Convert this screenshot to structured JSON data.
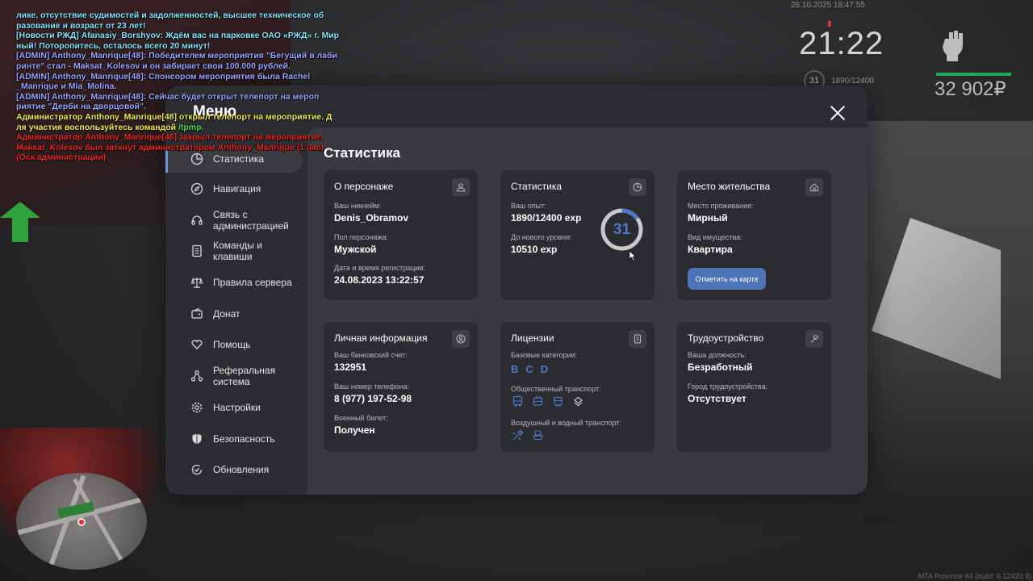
{
  "hud": {
    "datetime": "26.10.2025 18:47:55",
    "time": "21:22",
    "level": "31",
    "exp": "1890/12400",
    "money": "32 902₽",
    "build": "MTA Province #4 (build: 6.12420.9)"
  },
  "chat": [
    {
      "text": "лике, отсутствие судимостей и задолженностей, высшее техническое об",
      "color": "cyan"
    },
    {
      "text": "разование и возраст от 23 лет!",
      "color": "cyan"
    },
    {
      "text": "[Новости РЖД] Afanasiy_Borshyov: Ждём вас на парковке ОАО «РЖД» г. Мир",
      "color": "cyan"
    },
    {
      "text": "ный! Поторопитесь, осталось всего 20 минут!",
      "color": "cyan"
    },
    {
      "text": "[ADMIN] Anthony_Manrique[48]: Победителем мероприятия \"Бегущий в лаби",
      "color": "blue"
    },
    {
      "text": "ринте\" стал - Maksat_Kolesov и он забирает свои 100.000 рублей.",
      "color": "blue"
    },
    {
      "text": "[ADMIN] Anthony_Manrique[48]: Спонсором мероприятия была Rachel",
      "color": "blue"
    },
    {
      "text": "_Manrique и Mia_Molina.",
      "color": "blue"
    },
    {
      "text": "[ADMIN] Anthony_Manrique[48]: Сейчас будет открыт телепорт на мероп",
      "color": "blue"
    },
    {
      "text": "риятие \"Дерби на дворцовой\".",
      "color": "blue"
    },
    {
      "text": "Администратор Anthony_Manrique[48] открыл телепорт на мероприятие. Д",
      "color": "yellow"
    },
    {
      "text": "ля участия воспользуйтесь командой ",
      "color": "yellow",
      "extra": "/tpmp."
    },
    {
      "text": "Администратор Anthony_Manrique[48] закрыл телепорт на мероприятие.",
      "color": "red"
    },
    {
      "text": "Maksat_Kolesov был заткнут администратором Anthony_Manrique (1 час)",
      "color": "red"
    },
    {
      "text": "(Оск.администрации)",
      "color": "red"
    }
  ],
  "menu": {
    "title": "Меню",
    "section_title": "Статистика",
    "sidebar": [
      {
        "label": "Статистика",
        "icon": "pie-chart-icon"
      },
      {
        "label": "Навигация",
        "icon": "compass-icon"
      },
      {
        "label": "Связь с администрацией",
        "icon": "headset-icon"
      },
      {
        "label": "Команды и клавиши",
        "icon": "document-icon"
      },
      {
        "label": "Правила сервера",
        "icon": "scales-icon"
      },
      {
        "label": "Донат",
        "icon": "wallet-icon"
      },
      {
        "label": "Помощь",
        "icon": "heart-hand-icon"
      },
      {
        "label": "Реферальная система",
        "icon": "network-icon"
      },
      {
        "label": "Настройки",
        "icon": "gear-icon"
      },
      {
        "label": "Безопасность",
        "icon": "shield-icon"
      },
      {
        "label": "Обновления",
        "icon": "refresh-check-icon"
      }
    ],
    "cards": {
      "character": {
        "title": "О персонаже",
        "nickname_label": "Ваш никнейм:",
        "nickname": "Denis_Obramov",
        "gender_label": "Пол персонажа:",
        "gender": "Мужской",
        "reg_label": "Дата и время регистрации:",
        "reg": "24.08.2023 13:22:57"
      },
      "stats": {
        "title": "Статистика",
        "exp_label": "Ваш опыт:",
        "exp": "1890/12400 exp",
        "next_label": "До нового уровня:",
        "next": "10510 exp",
        "level": "31",
        "progress": 0.152
      },
      "residence": {
        "title": "Место жительства",
        "place_label": "Место проживания:",
        "place": "Мирный",
        "property_label": "Вид имущества:",
        "property": "Квартира",
        "map_button": "Отметить на карте"
      },
      "personal": {
        "title": "Личная информация",
        "bank_label": "Ваш банковский счет:",
        "bank": "132951",
        "phone_label": "Ваш номер телефона:",
        "phone": "8 (977) 197-52-98",
        "military_label": "Военный билет:",
        "military": "Получен"
      },
      "licenses": {
        "title": "Лицензии",
        "base_label": "Базовые категории:",
        "categories": [
          "B",
          "C",
          "D"
        ],
        "public_label": "Общественный транспорт:",
        "air_label": "Воздушный и водный транспорт:"
      },
      "employment": {
        "title": "Трудоустройство",
        "position_label": "Ваша должность:",
        "position": "Безработный",
        "city_label": "Город трудоустройства:",
        "city": "Отсутствует"
      }
    }
  },
  "colors": {
    "accent": "#4f78c8",
    "button": "#4d74b6",
    "panel": "#2c2d31",
    "content": "#393a3f",
    "card": "#2b2c30"
  }
}
